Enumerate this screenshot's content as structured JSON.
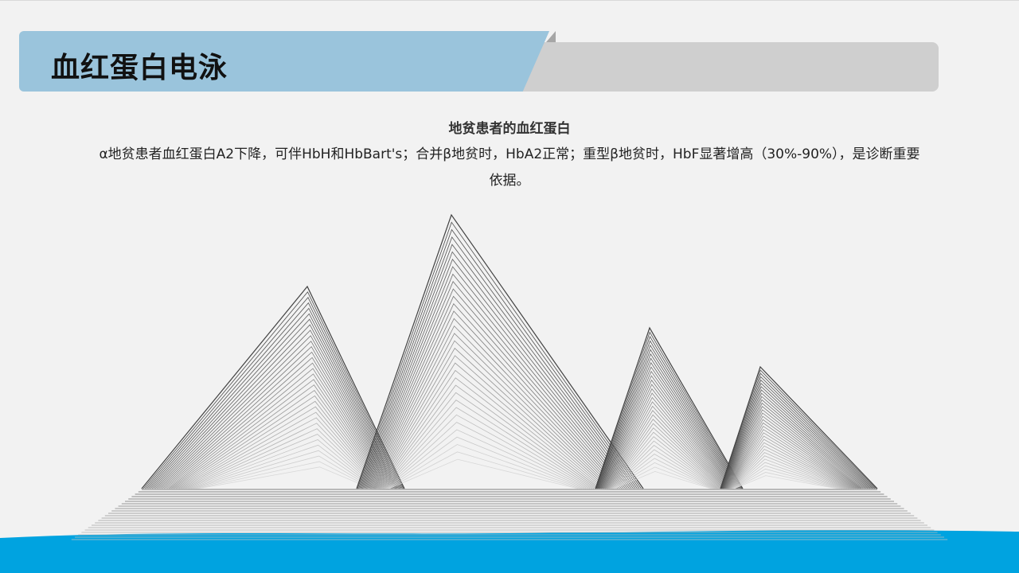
{
  "slide": {
    "title": "血红蛋白电泳",
    "subtitle": "地贫患者的血红蛋白",
    "body": "α地贫患者血红蛋白A2下降，可伴HbH和HbBart's；合并β地贫时，HbA2正常；重型β地贫时，HbF显著增高（30%-90%），是诊断重要依据。"
  },
  "colors": {
    "background": "#f2f2f2",
    "header_blue": "#9ac4dc",
    "header_gray": "#cfcfcf",
    "water": "#00a3e0"
  },
  "icons": [
    "mountain-line-art"
  ]
}
